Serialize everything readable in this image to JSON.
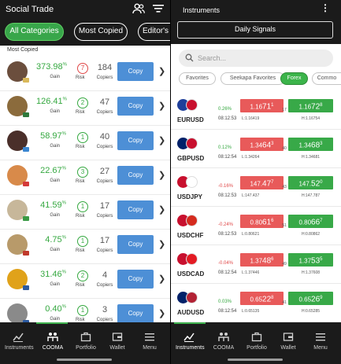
{
  "left": {
    "title": "Social Trade",
    "chips": [
      "All Categories",
      "Most Copied",
      "Editor's"
    ],
    "section": "Most Copied",
    "gain_label": "Gain",
    "risk_label": "Risk",
    "copiers_label": "Copiers",
    "copy_label": "Copy",
    "rows": [
      {
        "gain": "373.98",
        "risk": "7",
        "copiers": "184",
        "risk_color": "#e04848",
        "flag": "#d9b85a"
      },
      {
        "gain": "126.41",
        "risk": "2",
        "copiers": "47",
        "risk_color": "#35a840",
        "flag": "#2e7a3c"
      },
      {
        "gain": "58.97",
        "risk": "1",
        "copiers": "40",
        "risk_color": "#35a840",
        "flag": "#3a86d1"
      },
      {
        "gain": "22.67",
        "risk": "3",
        "copiers": "27",
        "risk_color": "#35a840",
        "flag": "#d43a3a"
      },
      {
        "gain": "41.59",
        "risk": "1",
        "copiers": "17",
        "risk_color": "#35a840",
        "flag": "#3b9a45"
      },
      {
        "gain": "4.75",
        "risk": "1",
        "copiers": "17",
        "risk_color": "#35a840",
        "flag": "#c0392b"
      },
      {
        "gain": "31.46",
        "risk": "2",
        "copiers": "4",
        "risk_color": "#35a840",
        "flag": "#2c5aa0"
      },
      {
        "gain": "0.40",
        "risk": "1",
        "copiers": "3",
        "risk_color": "#35a840",
        "flag": "#2c5aa0"
      }
    ],
    "nav": [
      "Instruments",
      "COOMA",
      "Portfolio",
      "Wallet",
      "Menu"
    ]
  },
  "right": {
    "title": "Instruments",
    "daily": "Daily Signals",
    "search_placeholder": "Search...",
    "chips": [
      "Favorites",
      "Seekapa Favorites",
      "Forex",
      "Commo"
    ],
    "rows": [
      {
        "sym": "EURUSD",
        "chg": "0.26%",
        "chg_color": "#35a840",
        "time": "08:12:53",
        "sell": [
          "1.16",
          "71",
          "1"
        ],
        "buy": [
          "1.16",
          "72",
          "8"
        ],
        "spread": "17",
        "low": "L:1.16419",
        "high": "H:1.16754"
      },
      {
        "sym": "GBPUSD",
        "chg": "0.12%",
        "chg_color": "#35a840",
        "time": "08:12:54",
        "sell": [
          "1.34",
          "64",
          "3"
        ],
        "buy": [
          "1.34",
          "68",
          "3"
        ],
        "spread": "40",
        "low": "L:1.34264",
        "high": "H:1.34681"
      },
      {
        "sym": "USDJPY",
        "chg": "-0.16%",
        "chg_color": "#e04848",
        "time": "08:12:53",
        "sell": [
          "147.",
          "47",
          "7"
        ],
        "buy": [
          "147.",
          "52",
          "0"
        ],
        "spread": "43",
        "low": "L:147.437",
        "high": "H:147.787"
      },
      {
        "sym": "USDCHF",
        "chg": "-0.24%",
        "chg_color": "#e04848",
        "time": "08:12:53",
        "sell": [
          "0.80",
          "61",
          "6"
        ],
        "buy": [
          "0.80",
          "66",
          "7"
        ],
        "spread": "51",
        "low": "L:0.80621",
        "high": "H:0.80862"
      },
      {
        "sym": "USDCAD",
        "chg": "-0.04%",
        "chg_color": "#e04848",
        "time": "08:12:54",
        "sell": [
          "1.37",
          "48",
          "6"
        ],
        "buy": [
          "1.37",
          "53",
          "5"
        ],
        "spread": "49",
        "low": "L:1.37446",
        "high": "H:1.37608"
      },
      {
        "sym": "AUDUSD",
        "chg": "0.03%",
        "chg_color": "#35a840",
        "time": "08:12:54",
        "sell": [
          "0.65",
          "22",
          "8"
        ],
        "buy": [
          "0.65",
          "26",
          "9"
        ],
        "spread": "41",
        "low": "L:0.65135",
        "high": "H:0.65285"
      }
    ],
    "nav": [
      "Instruments",
      "COOMA",
      "Portfolio",
      "Wallet",
      "Menu"
    ]
  }
}
